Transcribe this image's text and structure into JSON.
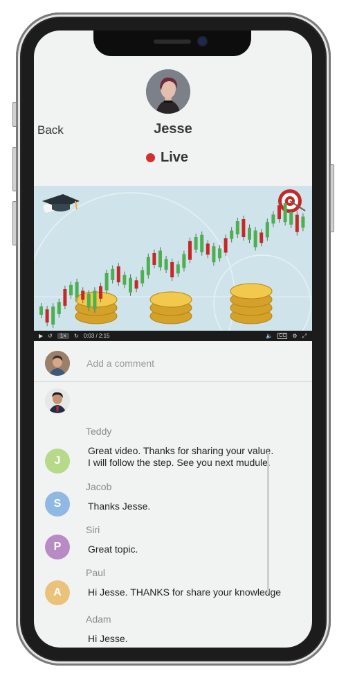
{
  "header": {
    "back_label": "Back",
    "host_name": "Jesse",
    "live_label": "Live"
  },
  "video": {
    "time_display": "0:03 / 2:15",
    "speed_label": "1×",
    "cc_label": "CC"
  },
  "comment_input": {
    "placeholder": "Add a comment"
  },
  "comments": [
    {
      "name": "Teddy",
      "text": "Great video. Thanks for sharing your value.\nI will follow the step. See you next mudule.",
      "avatar": "photo"
    },
    {
      "name": "Jacob",
      "text": "Thanks Jesse.",
      "initial": "J",
      "color": "#b7d98a"
    },
    {
      "name": "Siri",
      "text": "Great topic.",
      "initial": "S",
      "color": "#8fb8e3"
    },
    {
      "name": "Paul",
      "text": "Hi Jesse. THANKS for share your knowledge",
      "initial": "P",
      "color": "#b98bc4"
    },
    {
      "name": "Adam",
      "text": "Hi Jesse.",
      "initial": "A",
      "color": "#ebc27a"
    }
  ],
  "colors": {
    "live_dot": "#d32f2f",
    "screen_bg": "#f1f3f2",
    "candle_up": "#4caf50",
    "candle_down": "#c62828"
  }
}
